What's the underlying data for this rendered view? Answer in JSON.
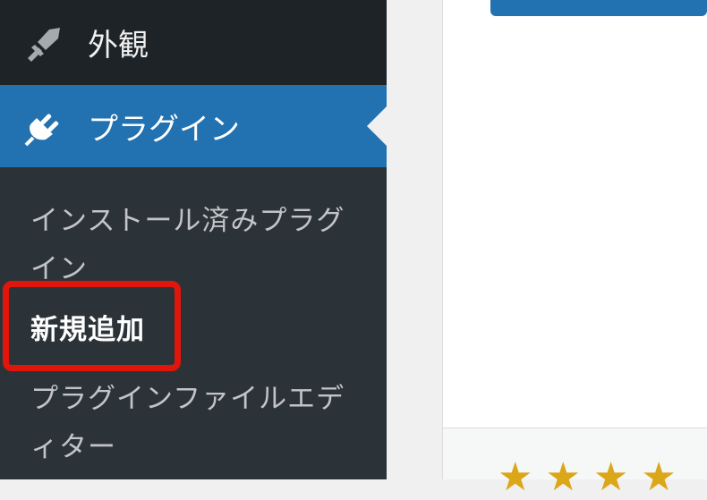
{
  "sidebar": {
    "appearance": {
      "label": "外観",
      "icon": "paintbrush-icon"
    },
    "plugins": {
      "label": "プラグイン",
      "icon": "plugin-icon"
    },
    "submenu": [
      {
        "label": "インストール済みプラグイン"
      },
      {
        "label": "新規追加",
        "current": true
      },
      {
        "label": "プラグインファイルエディター"
      }
    ]
  },
  "main": {
    "rating_stars": [
      "★",
      "★",
      "★",
      "★"
    ]
  },
  "colors": {
    "sidebar_bg": "#2c3338",
    "active_menu": "#2271b1",
    "highlight": "#e0150b",
    "star": "#dba617"
  }
}
